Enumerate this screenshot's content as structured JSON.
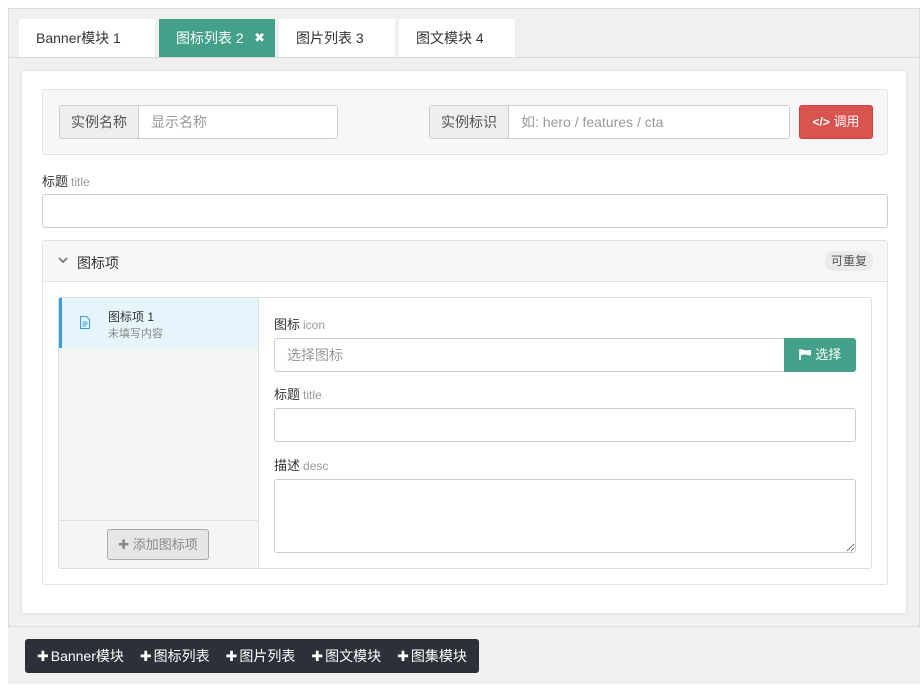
{
  "tabs": [
    {
      "label": "Banner模块 1",
      "active": false
    },
    {
      "label": "图标列表 2",
      "active": true
    },
    {
      "label": "图片列表 3",
      "active": false
    },
    {
      "label": "图文模块 4",
      "active": false
    }
  ],
  "tab_close_glyph": "✖",
  "instance": {
    "name_label": "实例名称",
    "name_placeholder": "显示名称",
    "id_label": "实例标识",
    "id_placeholder": "如: hero / features / cta",
    "call_button": "调用",
    "call_icon": "</>"
  },
  "title_field": {
    "label": "标题",
    "hint": "title",
    "value": ""
  },
  "group": {
    "title": "图标项",
    "badge": "可重复",
    "items": [
      {
        "title": "图标项 1",
        "subtitle": "未填写内容"
      }
    ],
    "add_button": "添加图标项",
    "form": {
      "icon_label": "图标",
      "icon_hint": "icon",
      "icon_placeholder": "选择图标",
      "pick_button": "选择",
      "title_label": "标题",
      "title_hint": "title",
      "desc_label": "描述",
      "desc_hint": "desc"
    }
  },
  "toolbar": {
    "buttons": [
      "Banner模块",
      "图标列表",
      "图片列表",
      "图文模块",
      "图集模块"
    ],
    "plus_glyph": "✚"
  },
  "colors": {
    "accent": "#45a089",
    "danger": "#d9534f",
    "toolbar_bg": "#2c3038",
    "selected_item_bg": "#e6f4fb",
    "selected_item_border": "#3c9ad8"
  }
}
